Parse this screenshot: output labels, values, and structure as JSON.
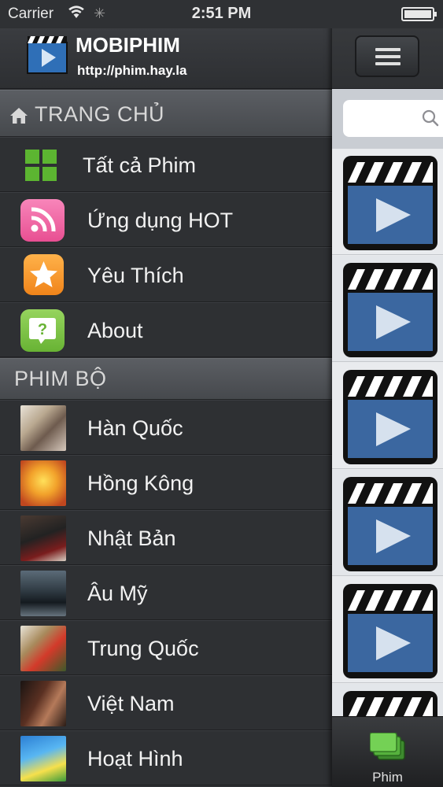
{
  "status_bar": {
    "carrier": "Carrier",
    "time": "2:51 PM"
  },
  "header": {
    "app_name": "MOBIPHIM",
    "url": "http://phim.hay.la"
  },
  "sections": {
    "home": {
      "title": "TRANG CHỦ"
    },
    "series": {
      "title": "PHIM BỘ"
    }
  },
  "home_items": [
    {
      "label": "Tất cả Phim",
      "icon": "grid-icon"
    },
    {
      "label": "Ứng dụng HOT",
      "icon": "rss-icon"
    },
    {
      "label": "Yêu Thích",
      "icon": "star-icon"
    },
    {
      "label": "About",
      "icon": "help-icon"
    }
  ],
  "series_items": [
    {
      "label": "Hàn Quốc"
    },
    {
      "label": "Hồng Kông"
    },
    {
      "label": "Nhật Bản"
    },
    {
      "label": "Âu Mỹ"
    },
    {
      "label": "Trung Quốc"
    },
    {
      "label": "Việt Nam"
    },
    {
      "label": "Hoạt Hình"
    }
  ],
  "search": {
    "placeholder": ""
  },
  "tab_bar": {
    "active_tab": "Phim"
  },
  "colors": {
    "menu_bg": "#2e3033",
    "section_header": "#4f5257",
    "grid_green": "#5cb531",
    "rss_pink": "#f0609e",
    "star_orange": "#f5921e",
    "help_green": "#7ac143"
  }
}
